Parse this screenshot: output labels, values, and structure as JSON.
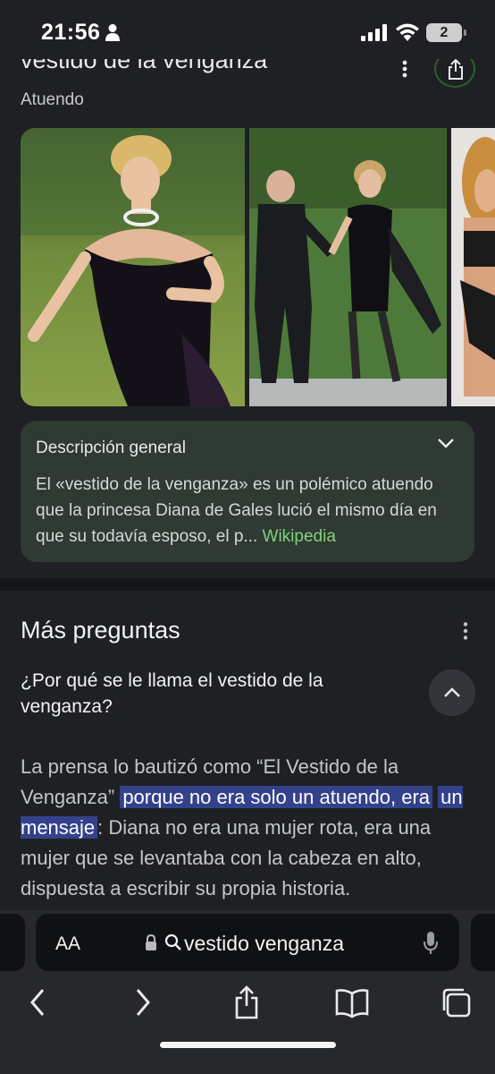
{
  "status_bar": {
    "time": "21:56",
    "battery_level": "2",
    "icons": [
      "person-icon",
      "cellular-signal-icon",
      "wifi-icon",
      "battery-icon"
    ]
  },
  "knowledge_panel": {
    "title": "vestido de la venganza",
    "subtitle": "Atuendo",
    "icons": [
      "more-vert-icon",
      "share-icon"
    ]
  },
  "overview": {
    "title": "Descripción general",
    "text": "El «vestido de la venganza»  es un polémico atuendo que la princesa Diana de Gales lució el mismo día en que su todavía esposo, el p...",
    "source": "Wikipedia"
  },
  "more_questions": {
    "title": "Más preguntas",
    "question": "¿Por qué se le llama el vestido de la venganza?",
    "answer_before": "La prensa lo bautizó como “El Vestido de la Venganza” ",
    "answer_highlight_1": "porque no era solo un atuendo, era",
    "answer_highlight_2": "un mensaje",
    "answer_after": ": Diana no era una mujer rota, era una mujer que se levantaba con la cabeza en alto, dispuesta a escribir su propia historia."
  },
  "browser": {
    "text_size_label": "AA",
    "address_text": "vestido venganza",
    "nav_icons": [
      "back-icon",
      "forward-icon",
      "share-icon",
      "bookmarks-icon",
      "tabs-icon"
    ]
  },
  "colors": {
    "background": "#1f2023",
    "card": "#2f3a32",
    "source_link": "#7fd17d",
    "highlight": "#34428c",
    "toolbar": "#27282b"
  }
}
